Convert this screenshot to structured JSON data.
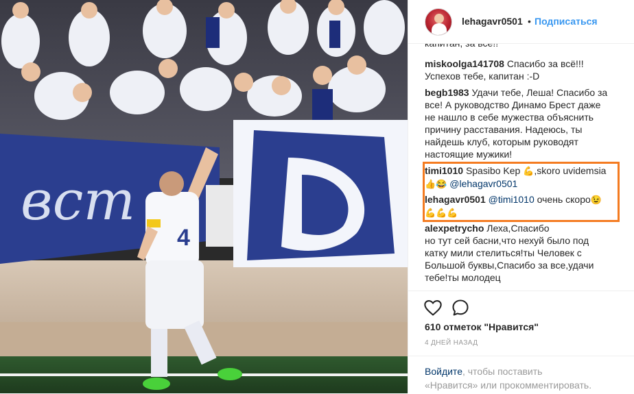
{
  "header": {
    "username": "lehagavr0501",
    "separator": "•",
    "follow_label": "Подписаться"
  },
  "comments_cutoff_text": "капитан, за всё!!",
  "comments": [
    {
      "author": "miskoolga141708",
      "text": "Спасибо за всё!!!",
      "text2": "Успехов тебе, капитан :-D"
    },
    {
      "author": "begb1983",
      "text": "Удачи тебе, Леша! Спасибо за",
      "lines": [
        "все! А руководство Динамо Брест даже",
        "не нашло в себе мужества объяснить",
        "причину расставания. Надеюсь, ты",
        "найдешь клуб, которым руководят",
        "настоящие мужики!"
      ]
    },
    {
      "author": "timi1010",
      "text": "Spasibo Kep",
      "emoji1": "💪",
      "text_b": ",skoro uvidemsia",
      "emoji2": "👍😂",
      "mention": "@lehagavr0501"
    },
    {
      "author": "lehagavr0501",
      "mention": "@timi1010",
      "text": "очень скоро",
      "emoji1": "😉",
      "emoji2": "💪💪💪"
    },
    {
      "author": "alexpetrycho",
      "text": "Леха,Спасибо",
      "lines": [
        "но тут сей басни,что нехуй было под",
        "катку мили стелиться!ты Человек с",
        "Большой буквы,Спасибо за все,удачи",
        "тебе!ты молодец"
      ]
    }
  ],
  "actions": {
    "like_icon": "heart-icon",
    "comment_icon": "comment-icon",
    "likes_text": "610 отметок \"Нравится\"",
    "time_text": "4 ДНЕЙ НАЗАД"
  },
  "login": {
    "link_text": "Войдите",
    "text1": ", чтобы поставить",
    "text2": "«Нравится» или прокомментировать."
  },
  "photo": {
    "description_colors": {
      "banner": "#2b3e8f",
      "shirt": "#ffffff",
      "wall": "#c9b9a8",
      "grass": "#3b6e3a"
    },
    "player_number": "4"
  },
  "accent_colors": {
    "link": "#3897f0",
    "highlight": "#f47b20",
    "mention": "#003569"
  }
}
